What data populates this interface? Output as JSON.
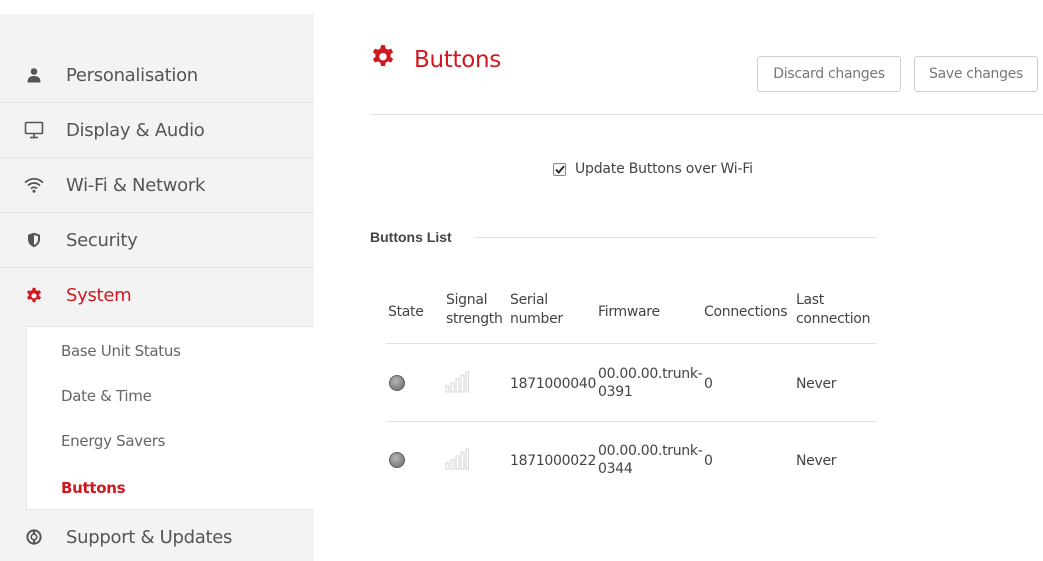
{
  "sidebar": {
    "items": [
      {
        "label": "Personalisation",
        "icon": "person-icon"
      },
      {
        "label": "Display & Audio",
        "icon": "monitor-icon"
      },
      {
        "label": "Wi-Fi & Network",
        "icon": "wifi-icon"
      },
      {
        "label": "Security",
        "icon": "shield-icon"
      },
      {
        "label": "System",
        "icon": "gear-icon"
      },
      {
        "label": "Support & Updates",
        "icon": "lifebuoy-icon"
      }
    ],
    "subitems": [
      {
        "label": "Base Unit Status"
      },
      {
        "label": "Date & Time"
      },
      {
        "label": "Energy Savers"
      },
      {
        "label": "Buttons"
      }
    ],
    "active_item": "System",
    "active_subitem": "Buttons"
  },
  "header": {
    "title": "Buttons",
    "discard_label": "Discard changes",
    "save_label": "Save changes"
  },
  "wifi_update": {
    "label": "Update Buttons over Wi-Fi",
    "checked": true
  },
  "buttons_list": {
    "title": "Buttons List",
    "columns": {
      "state": "State",
      "signal_1": "Signal",
      "signal_2": "strength",
      "serial_1": "Serial",
      "serial_2": "number",
      "firmware": "Firmware",
      "connections": "Connections",
      "last_1": "Last",
      "last_2": "connection"
    },
    "rows": [
      {
        "state": "offline",
        "signal_level": 0,
        "serial": "1871000040",
        "firmware_1": "00.00.00.trunk-",
        "firmware_2": "0391",
        "connections": "0",
        "last_connection": "Never"
      },
      {
        "state": "offline",
        "signal_level": 0,
        "serial": "1871000022",
        "firmware_1": "00.00.00.trunk-",
        "firmware_2": "0344",
        "connections": "0",
        "last_connection": "Never"
      }
    ]
  },
  "colors": {
    "accent": "#d0181f",
    "sidebar_bg": "#f3f3f3",
    "text": "#444444"
  }
}
